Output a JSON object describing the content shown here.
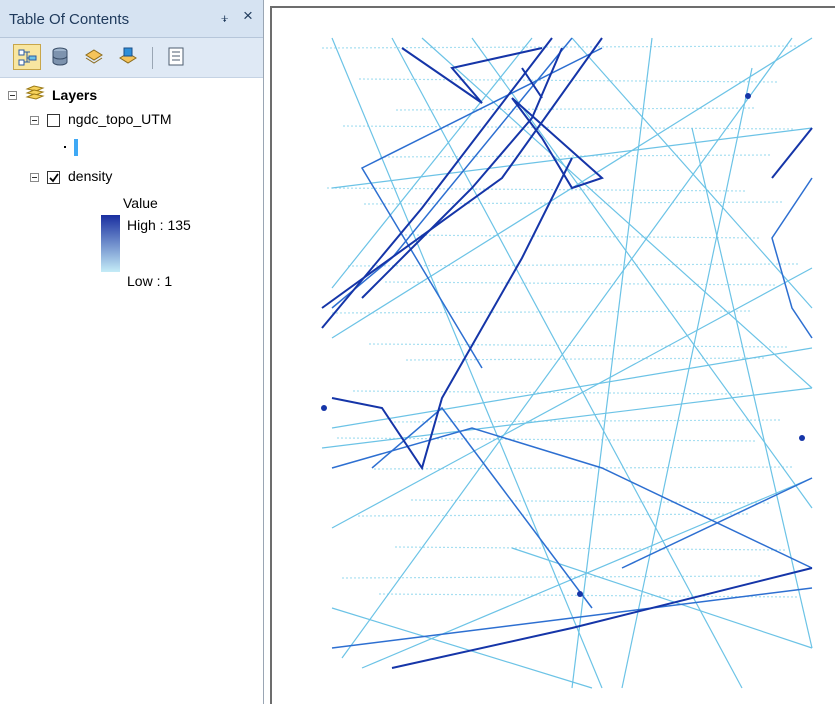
{
  "toc": {
    "title": "Table Of Contents",
    "pin_glyph": "⨨",
    "close_glyph": "×",
    "toolbar": [
      {
        "name": "list-by-drawing-order-button",
        "icon": "layers-list-icon",
        "active": true
      },
      {
        "name": "list-by-source-button",
        "icon": "database-icon",
        "active": false
      },
      {
        "name": "list-by-visibility-button",
        "icon": "visibility-layers-icon",
        "active": false
      },
      {
        "name": "list-by-selection-button",
        "icon": "selection-layers-icon",
        "active": false
      },
      {
        "name": "options-button",
        "icon": "options-list-icon",
        "active": false
      }
    ],
    "tree": {
      "root_label": "Layers",
      "layers": [
        {
          "name": "ngdc_topo_UTM",
          "checked": false,
          "legend_swatch_color": "#3fa9f5"
        },
        {
          "name": "density",
          "checked": true,
          "legend": {
            "heading": "Value",
            "high": "High : 135",
            "low": "Low : 1",
            "ramp_top": "#1a2fa0",
            "ramp_bottom": "#c5ecf7"
          }
        }
      ]
    }
  },
  "map": {
    "colors": {
      "dark": "#1535a8",
      "medium": "#2d6fd1",
      "light": "#6cc3e6",
      "pale": "#a7dff1"
    }
  }
}
